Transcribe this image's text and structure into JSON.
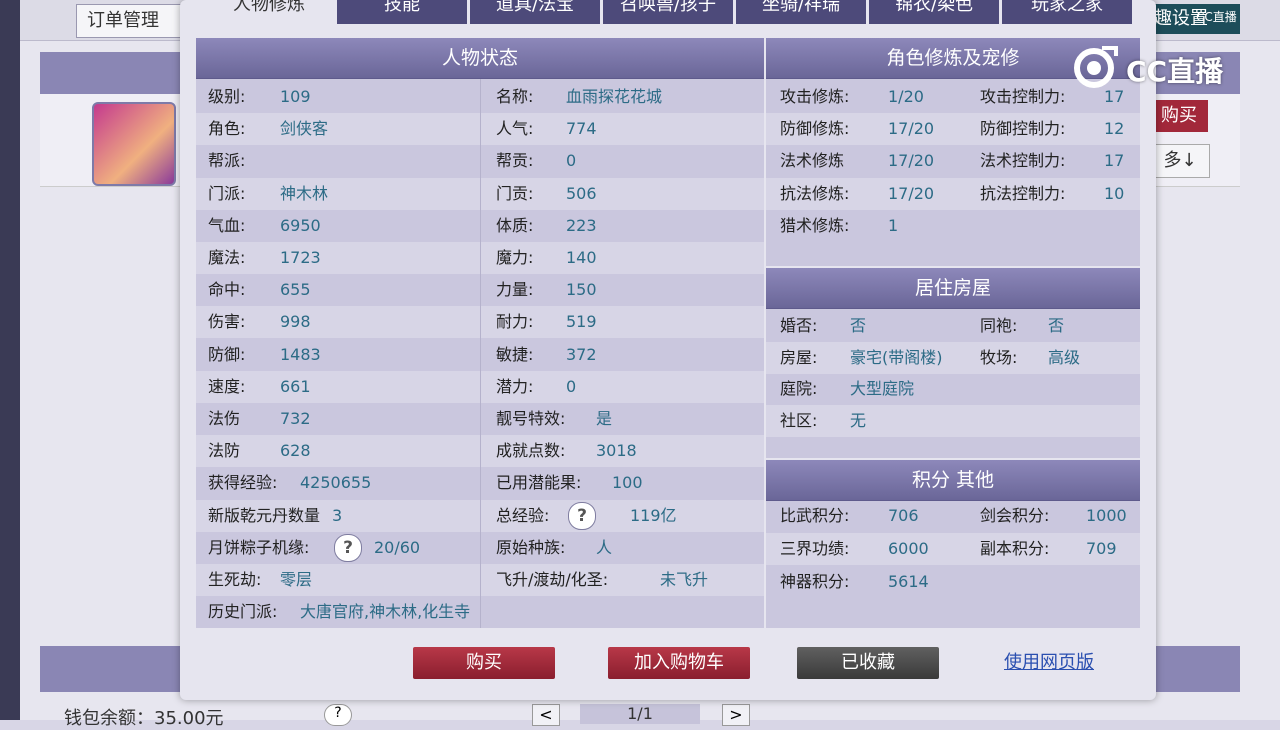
{
  "background": {
    "order_label": "订单管理",
    "settings_label": "趣设置",
    "buy_label": "购买",
    "more_label": "多↓",
    "wallet_label": "钱包余额：35.00元",
    "pager": {
      "prev": "<",
      "current": "1/1",
      "next": ">"
    }
  },
  "tabs": [
    "人物修炼",
    "技能",
    "道具/法宝",
    "召唤兽/孩子",
    "坐骑/祥瑞",
    "锦衣/染色",
    "玩家之家"
  ],
  "status_panel": {
    "title": "人物状态",
    "left": [
      {
        "label": "级别:",
        "value": "109"
      },
      {
        "label": "角色:",
        "value": "剑侠客"
      },
      {
        "label": "帮派:",
        "value": ""
      },
      {
        "label": "门派:",
        "value": "神木林"
      },
      {
        "label": "气血:",
        "value": "6950"
      },
      {
        "label": "魔法:",
        "value": "1723"
      },
      {
        "label": "命中:",
        "value": "655"
      },
      {
        "label": "伤害:",
        "value": "998"
      },
      {
        "label": "防御:",
        "value": "1483"
      },
      {
        "label": "速度:",
        "value": "661"
      },
      {
        "label": "法伤",
        "value": "732"
      },
      {
        "label": "法防",
        "value": "628"
      },
      {
        "label": "获得经验:",
        "value": "4250655"
      },
      {
        "label": "新版乾元丹数量",
        "value": "3"
      },
      {
        "label": "月饼粽子机缘:",
        "value": "20/60"
      },
      {
        "label": "生死劫:",
        "value": "零层"
      },
      {
        "label": "历史门派:",
        "value": "大唐官府,神木林,化生寺"
      }
    ],
    "right": [
      {
        "label": "名称:",
        "value": "血雨探花花城"
      },
      {
        "label": "人气:",
        "value": "774"
      },
      {
        "label": "帮贡:",
        "value": "0"
      },
      {
        "label": "门贡:",
        "value": "506"
      },
      {
        "label": "体质:",
        "value": "223"
      },
      {
        "label": "魔力:",
        "value": "140"
      },
      {
        "label": "力量:",
        "value": "150"
      },
      {
        "label": "耐力:",
        "value": "519"
      },
      {
        "label": "敏捷:",
        "value": "372"
      },
      {
        "label": "潜力:",
        "value": "0"
      },
      {
        "label": "靓号特效:",
        "value": "是"
      },
      {
        "label": "成就点数:",
        "value": "3018"
      },
      {
        "label": "已用潜能果:",
        "value": "100"
      },
      {
        "label": "总经验:",
        "value": "119亿"
      },
      {
        "label": "原始种族:",
        "value": "人"
      },
      {
        "label": "飞升/渡劫/化圣:",
        "value": "未飞升"
      }
    ]
  },
  "cultivation_panel": {
    "title": "角色修炼及宠修",
    "rows": [
      {
        "l1": "攻击修炼:",
        "v1": "1/20",
        "l2": "攻击控制力:",
        "v2": "17"
      },
      {
        "l1": "防御修炼:",
        "v1": "17/20",
        "l2": "防御控制力:",
        "v2": "12"
      },
      {
        "l1": "法术修炼",
        "v1": "17/20",
        "l2": "法术控制力:",
        "v2": "17"
      },
      {
        "l1": "抗法修炼:",
        "v1": "17/20",
        "l2": "抗法控制力:",
        "v2": "10"
      },
      {
        "l1": "猎术修炼:",
        "v1": "1",
        "l2": "",
        "v2": ""
      }
    ]
  },
  "housing_panel": {
    "title": "居住房屋",
    "rows": [
      {
        "l1": "婚否:",
        "v1": "否",
        "l2": "同袍:",
        "v2": "否"
      },
      {
        "l1": "房屋:",
        "v1": "豪宅(带阁楼)",
        "l2": "牧场:",
        "v2": "高级"
      },
      {
        "l1": "庭院:",
        "v1": "大型庭院",
        "l2": "",
        "v2": ""
      },
      {
        "l1": "社区:",
        "v1": "无",
        "l2": "",
        "v2": ""
      }
    ]
  },
  "score_panel": {
    "title": "积分 其他",
    "rows": [
      {
        "l1": "比武积分:",
        "v1": "706",
        "l2": "剑会积分:",
        "v2": "1000"
      },
      {
        "l1": "三界功绩:",
        "v1": "6000",
        "l2": "副本积分:",
        "v2": "709"
      },
      {
        "l1": "神器积分:",
        "v1": "5614",
        "l2": "",
        "v2": ""
      }
    ]
  },
  "actions": {
    "buy": "购买",
    "add_cart": "加入购物车",
    "favorited": "已收藏",
    "web_version": "使用网页版"
  },
  "watermark": {
    "text": "CC直播",
    "corner": "CC直播"
  },
  "colors": {
    "tab_bg": "#4d4a7a",
    "panel_header": "#7a76a8",
    "value_text": "#2c6b86",
    "red_button": "#9e2a3a",
    "gray_button": "#4a4a4a"
  }
}
